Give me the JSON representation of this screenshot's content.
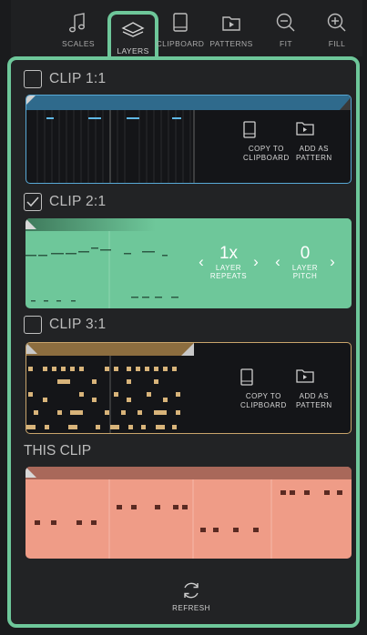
{
  "tabs": [
    {
      "label": "SCALES",
      "icon": "music-note-icon"
    },
    {
      "label": "LAYERS",
      "icon": "layers-icon",
      "active": true
    },
    {
      "label": "CLIPBOARD",
      "icon": "clipboard-icon"
    },
    {
      "label": "PATTERNS",
      "icon": "patterns-icon"
    },
    {
      "label": "FIT",
      "icon": "zoom-out-icon"
    },
    {
      "label": "FILL",
      "icon": "zoom-in-icon"
    }
  ],
  "clips": [
    {
      "title": "CLIP 1:1",
      "checked": false,
      "color": "#58a9d6",
      "actions": {
        "copy": "COPY TO\nCLIPBOARD",
        "add": "ADD AS\nPATTERN"
      }
    },
    {
      "title": "CLIP 2:1",
      "checked": true,
      "color": "#6ec79a",
      "layer_repeats": {
        "value": "1x",
        "label": "LAYER\nREPEATS"
      },
      "layer_pitch": {
        "value": "0",
        "label": "LAYER\nPITCH"
      }
    },
    {
      "title": "CLIP 3:1",
      "checked": false,
      "color": "#c9a56c",
      "actions": {
        "copy": "COPY TO\nCLIPBOARD",
        "add": "ADD AS\nPATTERN"
      }
    }
  ],
  "this_clip": {
    "title": "THIS CLIP",
    "color": "#ef9c87"
  },
  "refresh_label": "REFRESH",
  "colors": {
    "accent": "#6ec79a",
    "panel": "#222325",
    "background": "#1a1b1d"
  }
}
